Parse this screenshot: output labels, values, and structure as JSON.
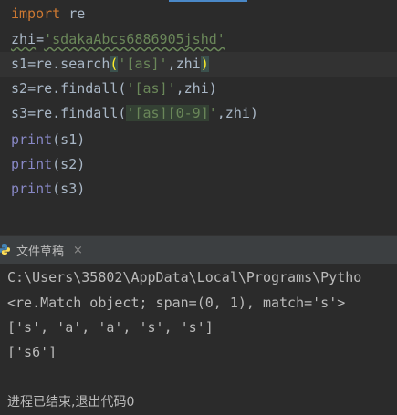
{
  "editor": {
    "lines": [
      {
        "parts": [
          [
            "kw",
            "import"
          ],
          [
            "plain",
            " re"
          ]
        ]
      },
      {
        "parts": [
          [
            "plain",
            "zhi"
          ],
          [
            "plain",
            "="
          ],
          [
            "str",
            "'sdakaAbcs6886905jshd'"
          ]
        ]
      },
      {
        "parts": [
          [
            "plain",
            "s1"
          ],
          [
            "plain",
            "=re.search"
          ],
          [
            "hl",
            "("
          ],
          [
            "str",
            "'[as]'"
          ],
          [
            "plain",
            ",zhi"
          ],
          [
            "hl",
            ")"
          ]
        ]
      },
      {
        "parts": [
          [
            "plain",
            "s2"
          ],
          [
            "plain",
            "=re.findall("
          ],
          [
            "str",
            "'[as]'"
          ],
          [
            "plain",
            ",zhi)"
          ]
        ]
      },
      {
        "parts": [
          [
            "plain",
            "s3"
          ],
          [
            "plain",
            "=re.findall("
          ],
          [
            "str",
            "'[as][0-9]'"
          ],
          [
            "plain",
            ",zhi)"
          ]
        ]
      },
      {
        "parts": [
          [
            "bi",
            "print"
          ],
          [
            "plain",
            "(s1)"
          ]
        ]
      },
      {
        "parts": [
          [
            "bi",
            "print"
          ],
          [
            "plain",
            "(s2)"
          ]
        ]
      },
      {
        "parts": [
          [
            "bi",
            "print"
          ],
          [
            "plain",
            "(s3)"
          ]
        ]
      }
    ],
    "line1": "import",
    "line1_rest": " re",
    "line2_var": "zhi",
    "line2_eq": "=",
    "line2_str": "'sdakaAbcs6886905jshd'",
    "line3_a": "s1",
    "line3_b": "=re.search",
    "line3_open": "(",
    "line3_str": "'[as]'",
    "line3_c": ",zhi",
    "line3_close": ")",
    "line4_a": "s2",
    "line4_b": "=re.findall(",
    "line4_str": "'[as]'",
    "line4_c": ",zhi)",
    "line5_a": "s3",
    "line5_b": "=re.findall(",
    "line5_str1": "'[as]",
    "line5_str2": "[0-9]",
    "line5_str3": "'",
    "line5_c": ",zhi)",
    "print_kw": "print",
    "line6_arg": "(s1)",
    "line7_arg": "(s2)",
    "line8_arg": "(s3)"
  },
  "run_tab": {
    "label": "文件草稿",
    "close": "×",
    "icon": "python-icon"
  },
  "console": {
    "lines": [
      "C:\\Users\\35802\\AppData\\Local\\Programs\\Pytho",
      "<re.Match object; span=(0, 1), match='s'>",
      "['s', 'a', 'a', 's', 's']",
      "['s6']"
    ],
    "exit_message": "进程已结束,退出代码0"
  },
  "colors": {
    "background": "#2b2b2b",
    "keyword": "#cc7832",
    "string": "#6a8759",
    "builtin": "#8888c6",
    "text": "#a9b7c6"
  }
}
